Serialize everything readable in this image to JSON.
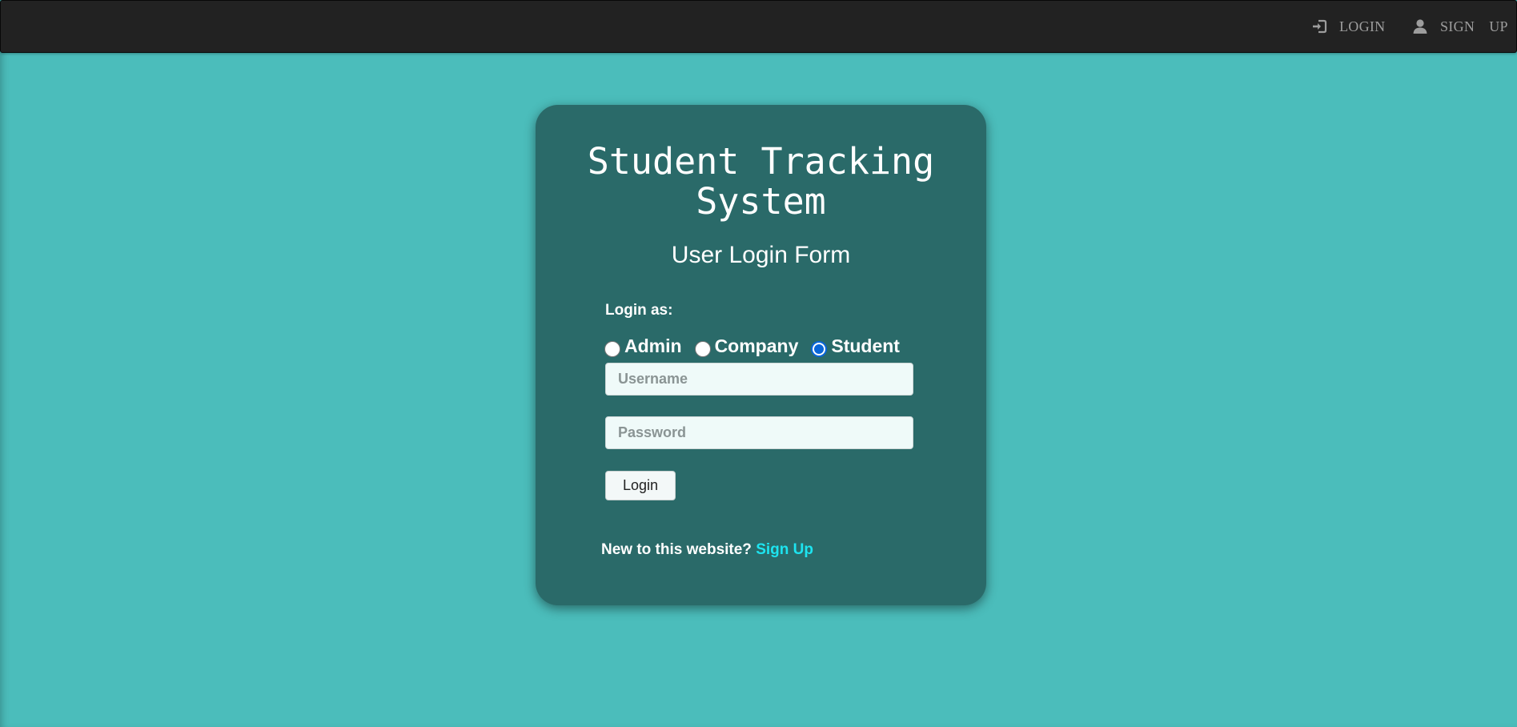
{
  "navbar": {
    "login_label": "LOGIN",
    "signup_label_1": "SIGN",
    "signup_label_2": "UP",
    "login_icon": "login-icon",
    "signup_icon": "user-icon"
  },
  "card": {
    "title": "Student Tracking System",
    "subtitle": "User Login Form",
    "login_as_label": "Login as:",
    "roles": [
      {
        "label": "Admin",
        "checked": false
      },
      {
        "label": "Company",
        "checked": false
      },
      {
        "label": "Student",
        "checked": true
      }
    ],
    "username_placeholder": "Username",
    "password_placeholder": "Password",
    "login_button": "Login",
    "new_user_text": "New to this website?",
    "signup_link": "Sign Up"
  },
  "colors": {
    "page_background": "#4bbdbb",
    "card_background": "#2a6a69",
    "navbar_background": "#222222",
    "link_accent": "#1de4f0",
    "radio_selected": "#0a66d8"
  }
}
